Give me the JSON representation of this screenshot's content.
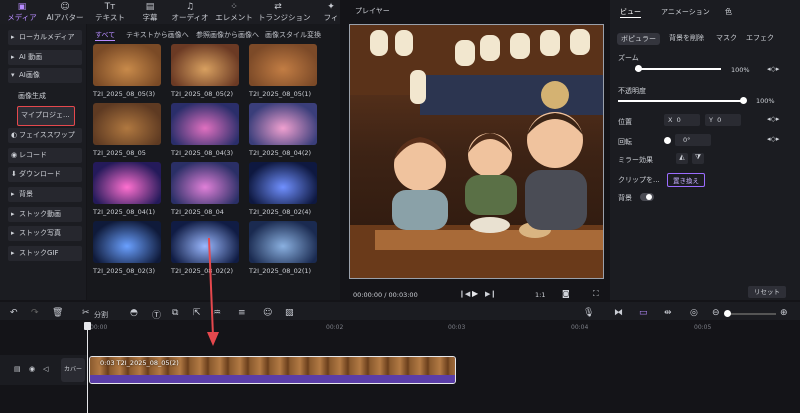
{
  "toolbar": {
    "tools": [
      {
        "label": "メディア",
        "icon": "▣"
      },
      {
        "label": "AIアバター",
        "icon": "☺"
      },
      {
        "label": "テキスト",
        "icon": "Tᴛ"
      },
      {
        "label": "字幕",
        "icon": "▤"
      },
      {
        "label": "オーディオ",
        "icon": "♫"
      },
      {
        "label": "エレメント",
        "icon": "⁘"
      },
      {
        "label": "トランジション",
        "icon": "⇄"
      },
      {
        "label": "フィ",
        "icon": "✦"
      }
    ]
  },
  "sidebar": {
    "items": [
      {
        "label": "ローカルメディア",
        "icon": "▸"
      },
      {
        "label": "AI 動画",
        "icon": "▸"
      },
      {
        "label": "AI画像",
        "icon": "▾"
      }
    ],
    "sub_items": [
      "画像生成",
      "マイプロジェ..."
    ],
    "items2": [
      {
        "label": "フェイススワップ",
        "icon": "◐"
      },
      {
        "label": "レコード",
        "icon": "◉"
      },
      {
        "label": "ダウンロード",
        "icon": "⬇"
      },
      {
        "label": "背景",
        "icon": "▸"
      },
      {
        "label": "ストック動画",
        "icon": "▸"
      },
      {
        "label": "ストック写真",
        "icon": "▸"
      },
      {
        "label": "ストックGIF",
        "icon": "▸"
      }
    ]
  },
  "filter_tabs": [
    "すべて",
    "テキストから画像へ",
    "参照画像から画像へ",
    "画像スタイル変換"
  ],
  "media_captions": [
    "T2I_2025_08_05(3)",
    "T2I_2025_08_05(2)",
    "T2I_2025_08_05(1)",
    "T2I_2025_08_05",
    "T2I_2025_08_04(3)",
    "T2I_2025_08_04(2)",
    "T2I_2025_08_04(1)",
    "T2I_2025_08_04",
    "T2I_2025_08_02(4)",
    "T2I_2025_08_02(3)",
    "T2I_2025_08_02(2)",
    "T2I_2025_08_02(1)"
  ],
  "player": {
    "title": "プレイヤー",
    "time": "00:00:00 / 00:03:00",
    "ratio": "1:1"
  },
  "props": {
    "tabs": [
      "ビュー",
      "アニメーション",
      "色"
    ],
    "pills": [
      "ボピュラー",
      "背景を削除",
      "マスク",
      "エフェク"
    ],
    "zoom_label": "ズーム",
    "zoom_value": "100%",
    "zoom_fraction": 1.0,
    "opacity_label": "不透明度",
    "opacity_value": "100%",
    "opacity_fraction": 1.0,
    "position_label": "位置",
    "x_label": "X",
    "x_value": "0",
    "y_label": "Y",
    "y_value": "0",
    "rotate_label": "回転",
    "rotate_value": "0°",
    "mirror_label": "ミラー効果",
    "clip_label": "クリップを...",
    "replace_label": "置き換え",
    "bg_label": "背景",
    "reset_label": "リセット"
  },
  "timeline": {
    "split_label": "分割",
    "ruler": [
      "00:00",
      "00:02",
      "00:03",
      "00:04",
      "00:05"
    ],
    "cover_label": "カバー",
    "clip_label": "0:03 T2I_2025_08_05(2)"
  },
  "colors": {
    "accent": "#9b6cff",
    "clip": "#5b3ea8",
    "highlight": "#e5484d"
  }
}
